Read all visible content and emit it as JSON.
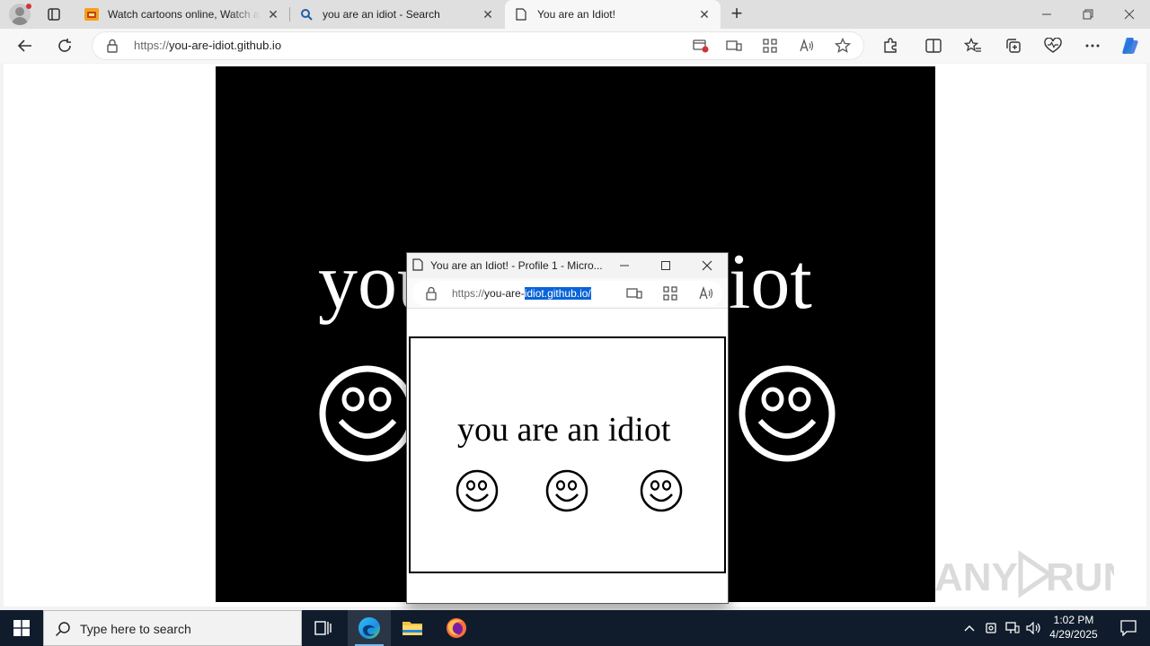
{
  "browser": {
    "tabs": [
      {
        "title": "Watch cartoons online, Watch anime online",
        "active": false
      },
      {
        "title": "you are an idiot - Search",
        "active": false
      },
      {
        "title": "You are an Idiot!",
        "active": true
      }
    ],
    "address": {
      "scheme": "https://",
      "host": "you-are-idiot.github.io"
    }
  },
  "page": {
    "big_text": "you are an idiot",
    "bg_color": "#000000",
    "fg_color": "#ffffff"
  },
  "popup": {
    "title": "You are an Idiot! - Profile 1 - Micro...",
    "url_dim": "https://",
    "url_pre": "you-are-",
    "url_sel": "idiot.github.io/",
    "text": "you are an idiot"
  },
  "watermark": {
    "text": "ANY RUN"
  },
  "taskbar": {
    "search_placeholder": "Type here to search",
    "time": "1:02 PM",
    "date": "4/29/2025"
  }
}
